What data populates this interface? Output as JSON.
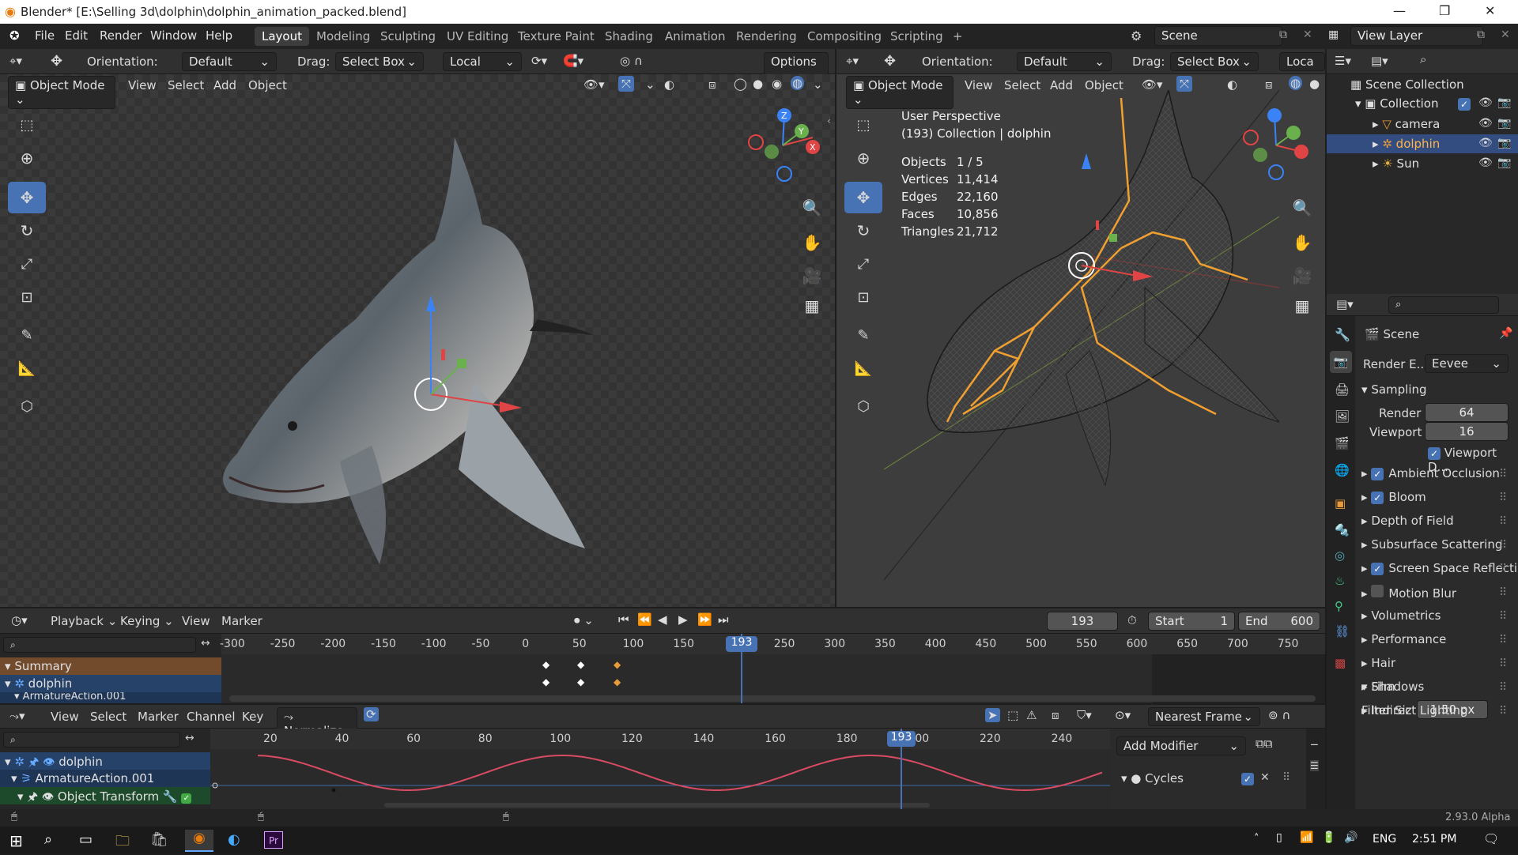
{
  "titlebar": {
    "title": "Blender* [E:\\Selling 3d\\dolphin\\dolphin_animation_packed.blend]",
    "min": "—",
    "max": "❐",
    "close": "✕"
  },
  "menu": {
    "file": "File",
    "edit": "Edit",
    "render": "Render",
    "window": "Window",
    "help": "Help"
  },
  "workspaces": [
    "Layout",
    "Modeling",
    "Sculpting",
    "UV Editing",
    "Texture Paint",
    "Shading",
    "Animation",
    "Rendering",
    "Compositing",
    "Scripting"
  ],
  "add_tab": "+",
  "scene": {
    "label": "Scene"
  },
  "view_layer": {
    "label": "View Layer"
  },
  "left_vp": {
    "orientation_label": "Orientation:",
    "orientation_value": "Default",
    "drag_label": "Drag:",
    "drag_value": "Select Box",
    "pivot_value": "Local",
    "options": "Options",
    "mode": "Object Mode",
    "view": "View",
    "select": "Select",
    "add": "Add",
    "object": "Object"
  },
  "right_vp": {
    "orientation_label": "Orientation:",
    "orientation_value": "Default",
    "drag_label": "Drag:",
    "drag_value": "Select Box",
    "pivot_value": "Loca",
    "mode": "Object Mode",
    "view": "View",
    "select": "Select",
    "add": "Add",
    "object": "Object",
    "persp": "User Perspective",
    "collection_info": "(193) Collection | dolphin",
    "stats": [
      {
        "k": "Objects",
        "v": "1 / 5"
      },
      {
        "k": "Vertices",
        "v": "11,414"
      },
      {
        "k": "Edges",
        "v": "22,160"
      },
      {
        "k": "Faces",
        "v": "10,856"
      },
      {
        "k": "Triangles",
        "v": "21,712"
      }
    ]
  },
  "gizmo": {
    "x": "X",
    "y": "Y",
    "z": "Z"
  },
  "outliner": {
    "root": "Scene Collection",
    "collection": "Collection",
    "items": [
      "camera",
      "dolphin",
      "Sun"
    ]
  },
  "properties": {
    "scene": "Scene",
    "render_engine_label": "Render E...",
    "render_engine": "Eevee",
    "sampling": "Sampling",
    "render_label": "Render",
    "render_val": "64",
    "viewport_label": "Viewport",
    "viewport_val": "16",
    "viewport_denoise": "Viewport D...",
    "panels": [
      {
        "name": "Ambient Occlusion",
        "checked": true,
        "has_cb": true
      },
      {
        "name": "Bloom",
        "checked": true,
        "has_cb": true
      },
      {
        "name": "Depth of Field",
        "has_cb": false
      },
      {
        "name": "Subsurface Scattering",
        "has_cb": false
      },
      {
        "name": "Screen Space Reflecti",
        "checked": true,
        "has_cb": true
      },
      {
        "name": "Motion Blur",
        "checked": false,
        "has_cb": true
      },
      {
        "name": "Volumetrics",
        "has_cb": false
      },
      {
        "name": "Performance",
        "has_cb": false
      },
      {
        "name": "Hair",
        "has_cb": false
      },
      {
        "name": "Shadows",
        "has_cb": false
      },
      {
        "name": "Indirect Lighting",
        "has_cb": false
      }
    ],
    "film": "Film",
    "filter_label": "Filter Siz",
    "filter_val": "1.50 px"
  },
  "timeline": {
    "playback": "Playback",
    "keying": "Keying",
    "view": "View",
    "marker": "Marker",
    "current": "193",
    "start_label": "Start",
    "start": "1",
    "end_label": "End",
    "end": "600",
    "ticks": [
      "-300",
      "-250",
      "-200",
      "-150",
      "-100",
      "-50",
      "0",
      "50",
      "100",
      "150",
      "193",
      "250",
      "300",
      "350",
      "400",
      "450",
      "500",
      "550",
      "600",
      "650",
      "700",
      "750"
    ],
    "summary": "Summary",
    "dolphin": "dolphin",
    "action": "ArmatureAction.001"
  },
  "graph": {
    "view": "View",
    "select": "Select",
    "marker": "Marker",
    "channel": "Channel",
    "key": "Key",
    "normalize": "Normalize",
    "snap": "Nearest Frame",
    "ticks": [
      "20",
      "40",
      "60",
      "80",
      "100",
      "120",
      "140",
      "160",
      "180",
      "193",
      "200",
      "220",
      "240"
    ],
    "channels": [
      "dolphin",
      "ArmatureAction.001",
      "Object Transform"
    ],
    "add_modifier": "Add Modifier",
    "modifier": "Cycles"
  },
  "status": {
    "version": "2.93.0 Alpha"
  },
  "taskbar": {
    "lang": "ENG",
    "time": "2:51 PM",
    "pr": "Pr"
  },
  "colors": {
    "accent": "#4772b3",
    "selected_orange": "#e89a3a",
    "curve": "#d94b63"
  }
}
